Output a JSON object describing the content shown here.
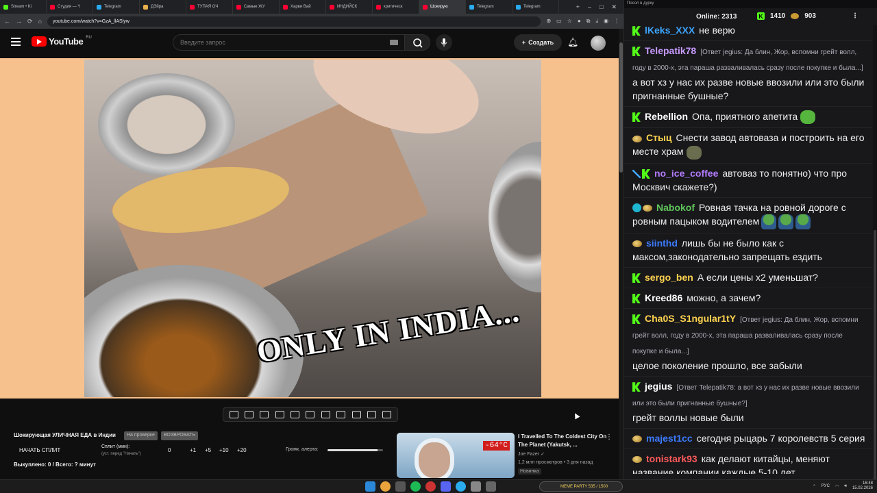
{
  "browser": {
    "tabs": [
      {
        "label": "Stream • Ki",
        "color": "#53fc18"
      },
      {
        "label": "Студия — Y",
        "color": "#ff0033"
      },
      {
        "label": "Telegram",
        "color": "#2aabee"
      },
      {
        "label": "ДЭйра",
        "color": "#e8b04a"
      },
      {
        "label": "ТУПАЯ ОЧ",
        "color": "#ff0033"
      },
      {
        "label": "Самые ЖУ",
        "color": "#ff0033"
      },
      {
        "label": "Харви Вай",
        "color": "#ff0033"
      },
      {
        "label": "ИНДИЙСК",
        "color": "#ff0033"
      },
      {
        "label": "критическ",
        "color": "#ff0033"
      },
      {
        "label": "Шокирую",
        "color": "#ff0033",
        "active": true
      },
      {
        "label": "Telegram",
        "color": "#2aabee"
      },
      {
        "label": "Telegram",
        "color": "#2aabee"
      }
    ],
    "new_tab": "+",
    "minimize": "–",
    "maximize": "□",
    "close": "✕",
    "url": "youtube.com/watch?v=GzA_llASlyw"
  },
  "youtube": {
    "logo": "YouTube",
    "region": "RU",
    "search_placeholder": "Введите запрос",
    "create_label": "Создать",
    "video": {
      "caption": "ONLY IN INDIA..."
    },
    "info": {
      "title": "Шокирующая УЛИЧНАЯ ЕДА в Индии",
      "badge_review": "На проверке",
      "badge_approve": "ВОЗВРОВАТЬ",
      "start_split": "НАЧАТЬ СПЛИТ",
      "split_label": "Сплит (мин):",
      "split_hint": "(уст. перед \"Начать\")",
      "split_values": [
        "0",
        "+1",
        "+5",
        "+10",
        "+20"
      ],
      "alert_label": "Громк. алерта:",
      "alert_volume": 0.9,
      "bought": "Выкуплено: 0 / Всего: ? минут"
    },
    "recommended": {
      "title": "I Travelled To The Coldest City On The Planet (Yakutsk, ...",
      "channel": "Joe Fazer",
      "meta": "1,2 млн просмотров • 3 дня назад",
      "new": "Новинка",
      "temp": "-64°C"
    }
  },
  "chat": {
    "window_title": "Посол в дурку",
    "online_label": "Online:",
    "online_count": "2313",
    "kick_count": "1410",
    "coin_count": "903",
    "messages": [
      {
        "user": "lKeks_XXX",
        "color": "#3ea6ff",
        "badges": [
          "k"
        ],
        "text": "не верю"
      },
      {
        "user": "Telepatik78",
        "color": "#c89bff",
        "badges": [
          "k"
        ],
        "reply": "[Ответ jegius: Да блин, Жор, вспомни грейт волл, году в 2000-х, эта параша разваливалась сразу после покупке и была...]",
        "text": "а вот хз у нас их разве новые ввозили или это были пригнанные бушные?"
      },
      {
        "user": "Rebellion",
        "color": "#ffffff",
        "badges": [
          "k"
        ],
        "text": "Опа, приятного апетита",
        "emote": "green"
      },
      {
        "user": "Стыц",
        "color": "#ffd34f",
        "badges": [
          "coin"
        ],
        "text": "Снести завод автоваза и построить на его месте храм",
        "emote": "gray"
      },
      {
        "user": "no_ice_coffee",
        "color": "#b47cff",
        "badges": [
          "sword",
          "k"
        ],
        "text": "автоваз то понятно) что про Москвич скажете?)"
      },
      {
        "user": "Nabokof",
        "color": "#5fc45a",
        "badges": [
          "ver",
          "coin"
        ],
        "text": "Ровная тачка на ровной дороге с ровным пацыком водителем",
        "pepe": 3
      },
      {
        "user": "siinthd",
        "color": "#3d7bff",
        "badges": [
          "coin"
        ],
        "text": "лишь бы не было как с максом,законодательно запрещать ездить"
      },
      {
        "user": "sergo_ben",
        "color": "#ffd34f",
        "badges": [
          "k"
        ],
        "text": "А если цены х2 уменьшат?"
      },
      {
        "user": "Kreed86",
        "color": "#ffffff",
        "badges": [
          "k"
        ],
        "text": "можно, а зачем?"
      },
      {
        "user": "Cha0S_S1ngular1tY",
        "color": "#ffd34f",
        "badges": [
          "k"
        ],
        "reply": "[Ответ jegius: Да блин, Жор, вспомни грейт волл, году в 2000-х, эта параша разваливалась сразу после покупке и была...]",
        "text": "целое поколение прошло, все забыли"
      },
      {
        "user": "jegius",
        "color": "#ffffff",
        "badges": [
          "k"
        ],
        "reply": "[Ответ Telepatik78: а вот хз у нас их разве новые ввозили или это были пригнанные бушные?]",
        "text": "грейт воллы новые были"
      },
      {
        "user": "majest1cc",
        "color": "#3d7bff",
        "badges": [
          "coin"
        ],
        "text": "сегодня рыцарь 7 королевств 5 серия"
      },
      {
        "user": "tonistark93",
        "color": "#ff5a5a",
        "badges": [
          "coin"
        ],
        "text": "как делают китайцы, меняют название компании каждые 5-10 лет"
      }
    ]
  },
  "taskbar": {
    "meme": "MEME PARTY 535 / 1500",
    "lang": "РУС",
    "time": "16:48",
    "date": "15.02.2026"
  }
}
